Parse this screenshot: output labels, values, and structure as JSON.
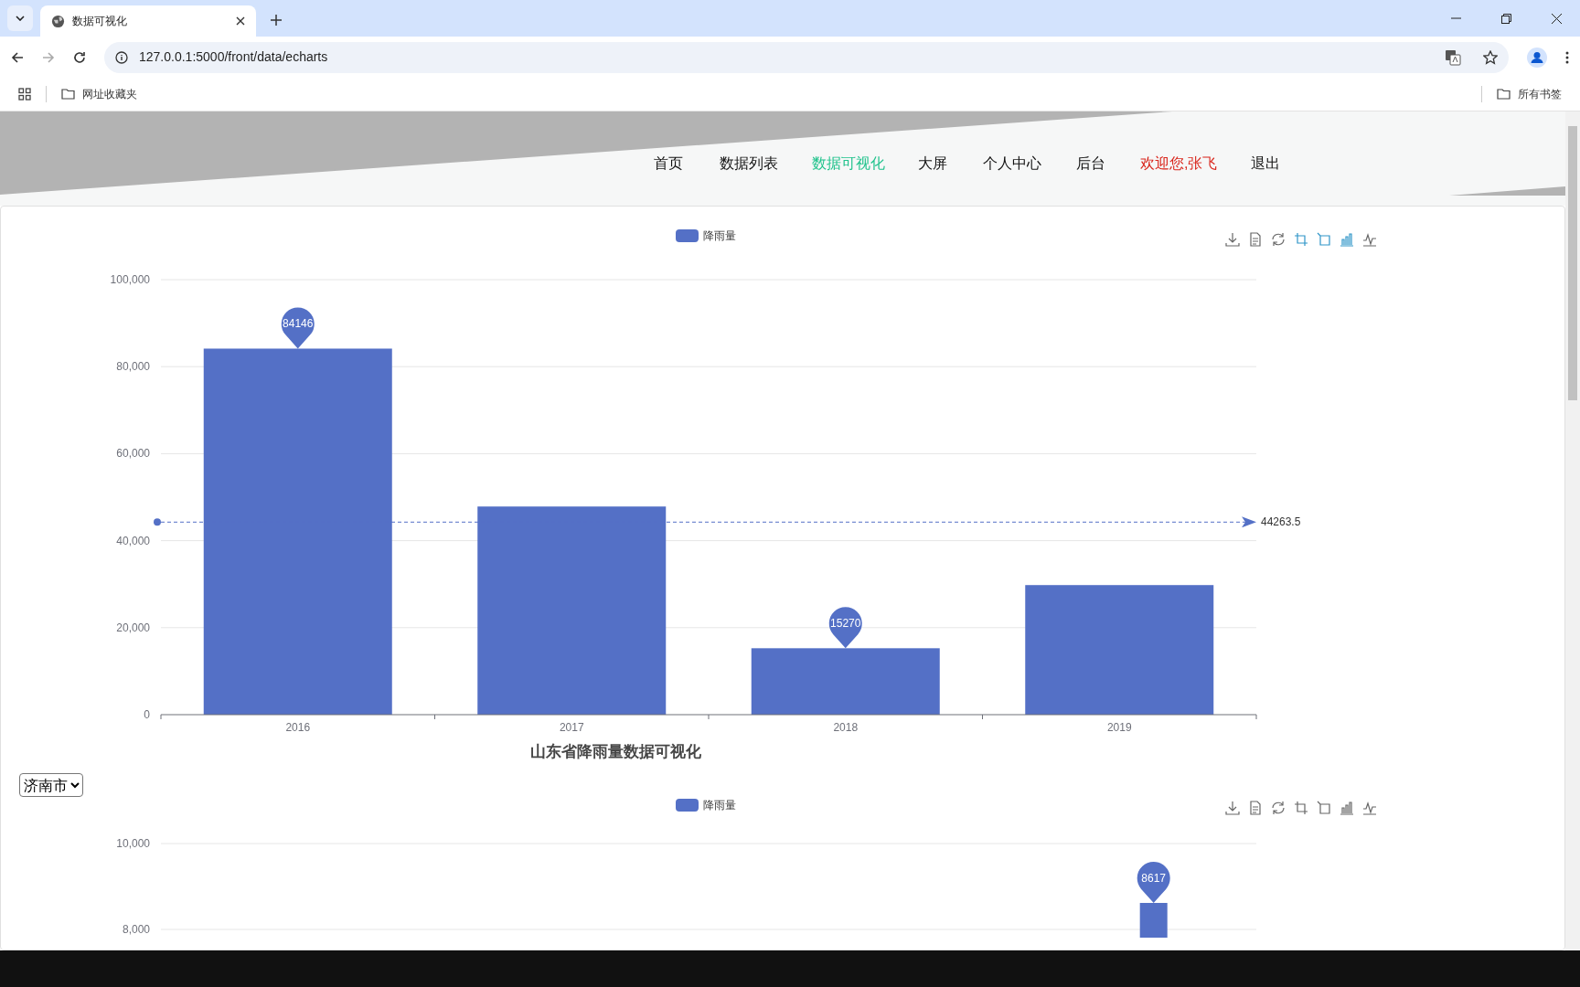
{
  "browser": {
    "tab_title": "数据可视化",
    "url": "127.0.0.1:5000/front/data/echarts",
    "bookmarks": [
      "网址收藏夹"
    ],
    "all_bookmarks": "所有书签"
  },
  "nav": [
    {
      "label": "首页",
      "selected": false,
      "kind": "link"
    },
    {
      "label": "数据列表",
      "selected": false,
      "kind": "link"
    },
    {
      "label": "数据可视化",
      "selected": true,
      "kind": "link"
    },
    {
      "label": "大屏",
      "selected": false,
      "kind": "link"
    },
    {
      "label": "个人中心",
      "selected": false,
      "kind": "link"
    },
    {
      "label": "后台",
      "selected": false,
      "kind": "link"
    },
    {
      "label": "欢迎您,张飞",
      "selected": false,
      "kind": "greeting"
    },
    {
      "label": "退出",
      "selected": false,
      "kind": "link"
    }
  ],
  "chart_1": {
    "chart_data": {
      "type": "bar",
      "title": "山东省降雨量数据可视化",
      "categories": [
        "2016",
        "2017",
        "2018",
        "2019"
      ],
      "series": [
        {
          "name": "降雨量",
          "color": "#5470c6",
          "values": [
            84146,
            47850,
            15270,
            29788
          ]
        }
      ],
      "ylim": [
        0,
        100000
      ],
      "yticks": [
        {
          "value": 0,
          "label": "0"
        },
        {
          "value": 20000,
          "label": "20,000"
        },
        {
          "value": 40000,
          "label": "40,000"
        },
        {
          "value": 60000,
          "label": "60,000"
        },
        {
          "value": 80000,
          "label": "80,000"
        },
        {
          "value": 100000,
          "label": "100,000"
        }
      ],
      "grid": true,
      "annotations": [
        {
          "text": "84146",
          "x": "2016",
          "y": 84146
        },
        {
          "text": "15270",
          "x": "2018",
          "y": 15270
        }
      ],
      "ref_lines": [
        {
          "axis": "y",
          "value": 44263.5,
          "label": "44263.5"
        }
      ]
    }
  },
  "city_select": {
    "value": "济南市"
  },
  "chart_2": {
    "chart_data": {
      "type": "bar",
      "series": [
        {
          "name": "降雨量",
          "color": "#5470c6",
          "values": [
            null,
            null,
            null,
            null,
            null,
            null,
            null,
            null,
            null,
            null,
            null,
            null,
            null,
            null,
            8617,
            null
          ]
        }
      ],
      "ylim": [
        0,
        10000
      ],
      "grid": true,
      "yticks": [
        {
          "value": 8000,
          "label": "8,000"
        },
        {
          "value": 10000,
          "label": "10,000"
        }
      ],
      "annotations": [
        {
          "text": "8617",
          "y": 8617
        }
      ]
    }
  }
}
